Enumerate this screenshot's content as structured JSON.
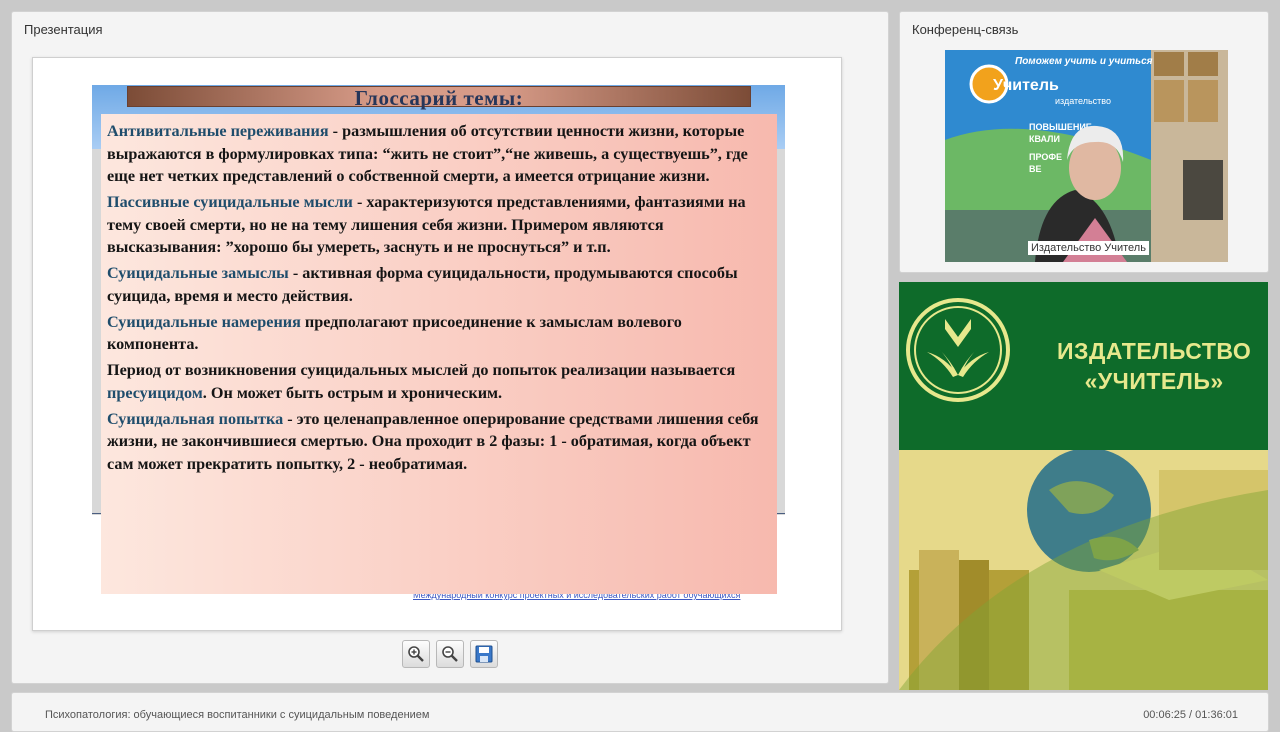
{
  "presentation": {
    "title": "Презентация",
    "slide": {
      "heading": "Глоссарий темы:",
      "paragraphs": [
        {
          "term": "Антивитальные переживания",
          "rest": " - размышления об отсутствии ценности жизни, которые выражаются в формулировках типа: “жить не стоит”,“не живешь, а существуешь”, где еще нет четких представлений о собственной смерти, а имеется отрицание жизни."
        },
        {
          "term": "Пассивные суицидальные мысли",
          "rest": " - характеризуются представлениями, фантазиями на тему своей смерти, но не на тему лишения себя жизни. Примером являются высказывания: ”хорошо бы умереть, заснуть и не проснуться” и т.п."
        },
        {
          "term": "Суицидальные замыслы",
          "rest": " - активная форма суицидальности, продумываются способы суицида, время и место действия."
        },
        {
          "term": "Суицидальные намерения",
          "rest": " предполагают присоединение к замыслам волевого компонента."
        },
        {
          "pre": "Период от возникновения суицидальных мыслей до попыток реализации называется ",
          "term": "пресуицидом",
          "rest": ". Он может быть острым и хроническим."
        },
        {
          "term": "Суицидальная попытка",
          "rest": " - это целенаправленное оперирование средствами лишения себя жизни, не закончившиеся смертью. Она проходит в 2 фазы: 1 - обратимая, когда объект сам может прекратить попытку, 2 - необратимая."
        }
      ],
      "footer_link": "Международный конкурс проектных и исследовательских работ обучающихся"
    },
    "tools": {
      "zoom_in_icon": "zoom-in-icon",
      "zoom_out_icon": "zoom-out-icon",
      "save_icon": "floppy-disk-icon"
    }
  },
  "conference": {
    "title": "Конференц-связь",
    "caption": "Издательство Учитель",
    "banner": {
      "top": "Поможем учить и учиться",
      "brand": "Учитель",
      "sub": "издательство",
      "items": [
        "ПОВЫШЕНИЕ",
        "КВАЛИ",
        "ПРОФЕ",
        "ВЕ"
      ]
    }
  },
  "ad": {
    "line1": "ИЗДАТЕЛЬСТВО",
    "line2": "«УЧИТЕЛЬ»"
  },
  "footer": {
    "webinar_title": "Психопатология: обучающиеся воспитанники с суицидальным поведением",
    "time": "00:06:25 / 01:36:01"
  },
  "colors": {
    "term": "#1f4d6c",
    "ad_green": "#0e6b2a",
    "ad_text": "#e7e88d"
  }
}
